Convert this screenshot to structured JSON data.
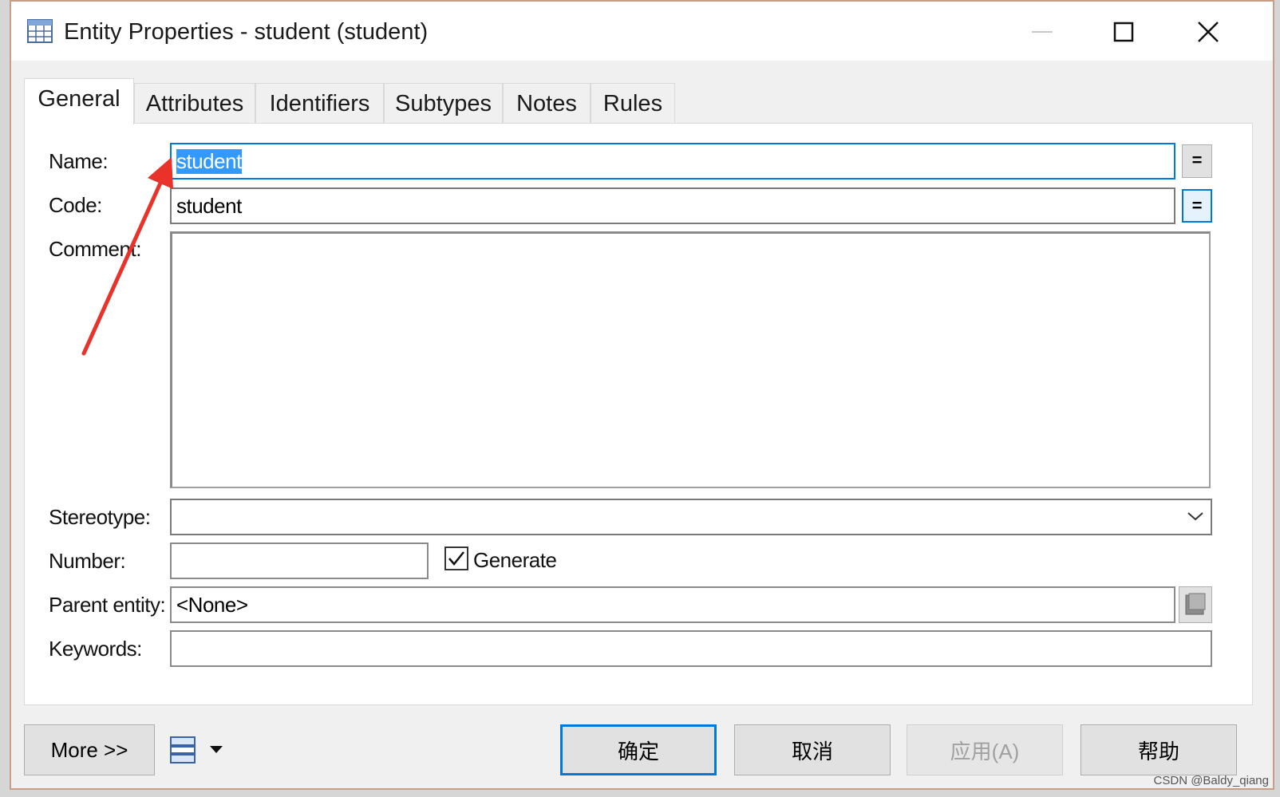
{
  "window": {
    "title": "Entity Properties - student (student)",
    "icons": {
      "app": "table-icon",
      "minimize": "minimize-icon",
      "maximize": "maximize-icon",
      "close": "close-icon"
    }
  },
  "tabs": [
    {
      "label": "General",
      "active": true
    },
    {
      "label": "Attributes",
      "active": false
    },
    {
      "label": "Identifiers",
      "active": false
    },
    {
      "label": "Subtypes",
      "active": false
    },
    {
      "label": "Notes",
      "active": false
    },
    {
      "label": "Rules",
      "active": false
    }
  ],
  "form": {
    "name_label": "Name:",
    "name_value": "student",
    "code_label": "Code:",
    "code_value": "student",
    "eq_label": "=",
    "comment_label": "Comment:",
    "comment_value": "",
    "stereotype_label": "Stereotype:",
    "stereotype_value": "",
    "number_label": "Number:",
    "number_value": "",
    "generate_label": "Generate",
    "generate_checked": true,
    "parent_label": "Parent entity:",
    "parent_value": "<None>",
    "keywords_label": "Keywords:",
    "keywords_value": ""
  },
  "footer": {
    "more_label": "More >>",
    "ok_label": "确定",
    "cancel_label": "取消",
    "apply_label": "应用(A)",
    "help_label": "帮助"
  },
  "watermark": "CSDN @Baldy_qiang",
  "colors": {
    "accent": "#0078d7",
    "selection": "#3399ff",
    "annotation_arrow": "#e8322a",
    "window_border": "#c89f86"
  }
}
